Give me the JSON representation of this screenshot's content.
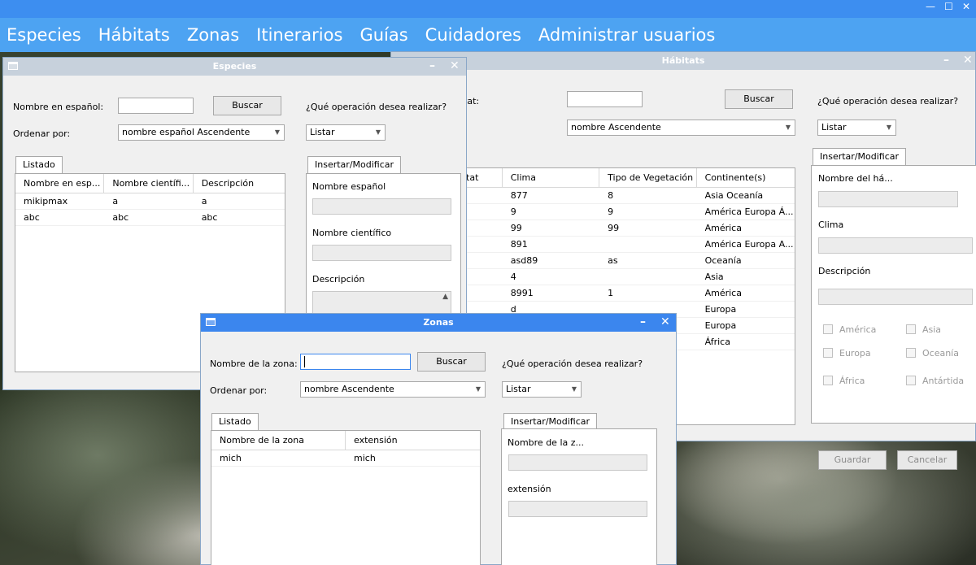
{
  "menubar": {
    "items": [
      "Especies",
      "Hábitats",
      "Zonas",
      "Itinerarios",
      "Guías",
      "Cuidadores",
      "Administrar usuarios"
    ],
    "window_controls": [
      "—",
      "☐",
      "✕"
    ]
  },
  "habitats": {
    "title": "Hábitats",
    "search_label": "itat:",
    "search_button": "Buscar",
    "operation_question": "¿Qué operación desea realizar?",
    "order_value": "nombre Ascendente",
    "operation_value": "Listar",
    "columns": [
      "itat",
      "Clima",
      "Tipo de Vegetación",
      "Continente(s)"
    ],
    "rows": [
      [
        "",
        "877",
        "8",
        "Asia Oceanía"
      ],
      [
        "",
        "9",
        "9",
        "América Europa Á..."
      ],
      [
        "",
        "99",
        "99",
        "América"
      ],
      [
        "",
        "891",
        "",
        "América Europa A..."
      ],
      [
        "",
        "asd89",
        "as",
        "Oceanía"
      ],
      [
        "",
        "4",
        "",
        "Asia"
      ],
      [
        "",
        "8991",
        "1",
        "América"
      ],
      [
        "",
        "d",
        "",
        "Europa"
      ],
      [
        "",
        "",
        "",
        "Europa"
      ],
      [
        "",
        "",
        "",
        "África"
      ]
    ],
    "form": {
      "tab": "Insertar/Modificar",
      "name_label": "Nombre del há...",
      "clima_label": "Clima",
      "descripcion_label": "Descripción",
      "continents": [
        "América",
        "Asia",
        "Europa",
        "Oceanía",
        "África",
        "Antártida"
      ],
      "save_button": "Guardar",
      "cancel_button": "Cancelar"
    }
  },
  "especies": {
    "title": "Especies",
    "search_label": "Nombre en español:",
    "search_button": "Buscar",
    "order_label": "Ordenar por:",
    "order_value": "nombre español Ascendente",
    "operation_question": "¿Qué operación desea realizar?",
    "operation_value": "Listar",
    "list_tab": "Listado",
    "columns": [
      "Nombre en esp...",
      "Nombre científi...",
      "Descripción"
    ],
    "rows": [
      [
        "mikipmax",
        "a",
        "a"
      ],
      [
        "abc",
        "abc",
        "abc"
      ]
    ],
    "form": {
      "tab": "Insertar/Modificar",
      "name_label": "Nombre español",
      "sci_label": "Nombre científico",
      "desc_label": "Descripción"
    }
  },
  "zonas": {
    "title": "Zonas",
    "search_label": "Nombre de la zona:",
    "search_button": "Buscar",
    "order_label": "Ordenar por:",
    "order_value": "nombre Ascendente",
    "operation_question": "¿Qué operación desea realizar?",
    "operation_value": "Listar",
    "list_tab": "Listado",
    "columns": [
      "Nombre de la zona",
      "extensión"
    ],
    "rows": [
      [
        "mich",
        "mich"
      ]
    ],
    "form": {
      "tab": "Insertar/Modificar",
      "name_label": "Nombre de la z...",
      "ext_label": "extensión"
    }
  }
}
